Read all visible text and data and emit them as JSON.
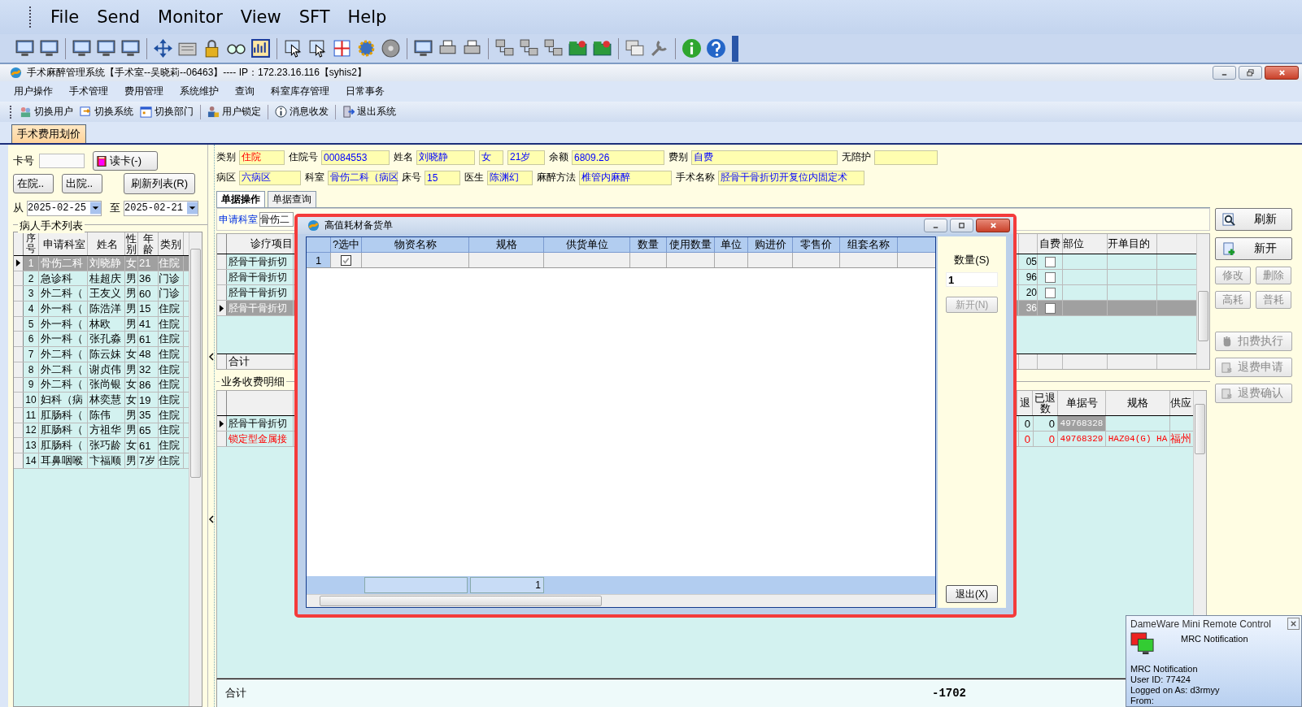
{
  "remote_menu": [
    "File",
    "Send",
    "Monitor",
    "View",
    "SFT",
    "Help"
  ],
  "app": {
    "title": "手术麻醉管理系统【手术室--吴晓莉--06463】---- IP：172.23.16.116【syhis2】",
    "menu": [
      "用户操作",
      "手术管理",
      "费用管理",
      "系统维护",
      "查询",
      "科室库存管理",
      "日常事务"
    ],
    "toolbar": [
      "切换用户",
      "切换系统",
      "切换部门",
      "用户锁定",
      "消息收发",
      "退出系统"
    ]
  },
  "doc_tabs": [
    {
      "label": "手术费用划价",
      "selected": true
    }
  ],
  "left": {
    "card_label": "卡号",
    "read_card_button": "读卡(-)",
    "status_buttons": [
      "在院..",
      "出院.."
    ],
    "refresh_button": "刷新列表(R)",
    "from_label": "从",
    "from_date": "2025-02-25",
    "to_label": "至",
    "to_date": "2025-02-21",
    "list_title": "病人手术列表",
    "columns": [
      "序号",
      "申请科室",
      "姓名",
      "性别",
      "年龄",
      "类别"
    ],
    "rows": [
      {
        "cells": [
          "1",
          "骨伤二科",
          "刘晓静",
          "女",
          "21",
          "住院"
        ],
        "selected": true
      },
      {
        "cells": [
          "2",
          "急诊科",
          "桂超庆",
          "男",
          "36",
          "门诊"
        ],
        "selected": false
      },
      {
        "cells": [
          "3",
          "外二科（",
          "王友义",
          "男",
          "60",
          "门诊"
        ],
        "selected": false
      },
      {
        "cells": [
          "4",
          "外一科（",
          "陈浩洋",
          "男",
          "15",
          "住院"
        ],
        "selected": false
      },
      {
        "cells": [
          "5",
          "外一科（",
          "林欧",
          "男",
          "41",
          "住院"
        ],
        "selected": false
      },
      {
        "cells": [
          "6",
          "外一科（",
          "张孔淼",
          "男",
          "61",
          "住院"
        ],
        "selected": false
      },
      {
        "cells": [
          "7",
          "外二科（",
          "陈云妹",
          "女",
          "48",
          "住院"
        ],
        "selected": false
      },
      {
        "cells": [
          "8",
          "外二科（",
          "谢贞伟",
          "男",
          "32",
          "住院"
        ],
        "selected": false
      },
      {
        "cells": [
          "9",
          "外二科（",
          "张尚银",
          "女",
          "86",
          "住院"
        ],
        "selected": false
      },
      {
        "cells": [
          "10",
          "妇科（病",
          "林奕慧",
          "女",
          "19",
          "住院"
        ],
        "selected": false
      },
      {
        "cells": [
          "11",
          "肛肠科（",
          "陈伟",
          "男",
          "35",
          "住院"
        ],
        "selected": false
      },
      {
        "cells": [
          "12",
          "肛肠科（",
          "方祖华",
          "男",
          "65",
          "住院"
        ],
        "selected": false
      },
      {
        "cells": [
          "13",
          "肛肠科（",
          "张巧龄",
          "女",
          "61",
          "住院"
        ],
        "selected": false
      },
      {
        "cells": [
          "14",
          "耳鼻咽喉",
          "卞福顺",
          "男",
          "7岁",
          "住院"
        ],
        "selected": false
      }
    ]
  },
  "form": [
    [
      {
        "label": "类别",
        "value": "住院",
        "emphasis": true
      },
      {
        "label": "住院号",
        "value": "00084553",
        "emphasis": false
      },
      {
        "label": "姓名",
        "value": "刘晓静",
        "emphasis": false
      },
      {
        "value": "女",
        "emphasis": false
      },
      {
        "value": "21岁",
        "emphasis": false
      },
      {
        "label": "余额",
        "value": "6809.26",
        "emphasis": false
      },
      {
        "label": "费别",
        "value": "自费",
        "emphasis": false
      },
      {
        "label": "无陪护"
      }
    ],
    [
      {
        "label": "病区",
        "value": "六病区",
        "emphasis": false
      },
      {
        "label": "科室",
        "value": "骨伤二科（病区",
        "emphasis": false
      },
      {
        "label": "床号",
        "value": "15",
        "emphasis": false
      },
      {
        "label": "医生",
        "value": "陈渊幻",
        "emphasis": false
      },
      {
        "label": "麻醉方法",
        "value": "椎管内麻醉",
        "emphasis": false
      },
      {
        "label": "手术名称",
        "value": "胫骨干骨折切开复位内固定术",
        "emphasis": false
      }
    ]
  ],
  "sub_tabs": [
    {
      "label": "单据操作",
      "selected": true
    },
    {
      "label": "单据查询",
      "selected": false
    }
  ],
  "dept_filter": {
    "label": "申请科室",
    "value": "骨伤二"
  },
  "items_grid": {
    "columns": {
      "item": "诊疗项目",
      "self_pay": "自费",
      "site": "部位",
      "purpose": "开单目的"
    },
    "rows": [
      {
        "item": "胫骨干骨折切",
        "column_3": "05",
        "self_pay": false,
        "selected": false
      },
      {
        "item": "胫骨干骨折切",
        "column_3": "96",
        "self_pay": false,
        "selected": false
      },
      {
        "item": "胫骨干骨折切",
        "column_3": "20",
        "self_pay": false,
        "selected": false
      },
      {
        "item": "胫骨干骨折切",
        "column_3": "36",
        "self_pay": false,
        "selected": true
      }
    ],
    "total_label": "合计"
  },
  "detail": {
    "title": "业务收费明细",
    "columns": {
      "refund": "退",
      "refunded": "已退数",
      "bill_no": "单据号",
      "spec": "规格",
      "supplier": "供应"
    },
    "rows": [
      {
        "item": "胫骨干骨折切",
        "refund": "0",
        "refunded": "0",
        "bill_no": "49768328",
        "selected": true,
        "emphasis": false
      },
      {
        "item": "锁定型金属接",
        "refund": "0",
        "refunded": "0",
        "bill_no": "49768329",
        "spec": "HAZ04(G) HA",
        "supplier": "福州",
        "selected": false,
        "emphasis": true
      }
    ]
  },
  "footer": {
    "label": "合计",
    "amount": "-1702"
  },
  "actions": [
    {
      "label": "刷新",
      "kind": "large",
      "disabled": false
    },
    {
      "label": "新开",
      "kind": "large",
      "disabled": false
    },
    {
      "label": "修改",
      "kind": "small",
      "disabled": true
    },
    {
      "label": "删除",
      "kind": "small",
      "disabled": true
    },
    {
      "label": "高耗",
      "kind": "small",
      "disabled": true
    },
    {
      "label": "普耗",
      "kind": "small",
      "disabled": true
    },
    {
      "label": "扣费执行",
      "kind": "wide",
      "disabled": true
    },
    {
      "label": "退费申请",
      "kind": "wide",
      "disabled": true
    },
    {
      "label": "退费确认",
      "kind": "wide",
      "disabled": true
    }
  ],
  "dialog": {
    "title": "高值耗材备货单",
    "columns": [
      "?选中",
      "物资名称",
      "规格",
      "供货单位",
      "数量",
      "使用数量",
      "单位",
      "购进价",
      "零售价",
      "组套名称"
    ],
    "rows": [
      {
        "number": "1",
        "checked": true
      }
    ],
    "summary_value": "1",
    "quantity_label": "数量(S)",
    "quantity_value": "1",
    "new_button": {
      "label": "新开(N)",
      "disabled": true
    },
    "exit_button": "退出(X)"
  },
  "popup": {
    "title": "DameWare Mini Remote Control",
    "heading": "MRC Notification",
    "lines": [
      "MRC Notification",
      "User ID: 77424",
      "Logged on As: d3rmyy",
      "From:"
    ]
  }
}
